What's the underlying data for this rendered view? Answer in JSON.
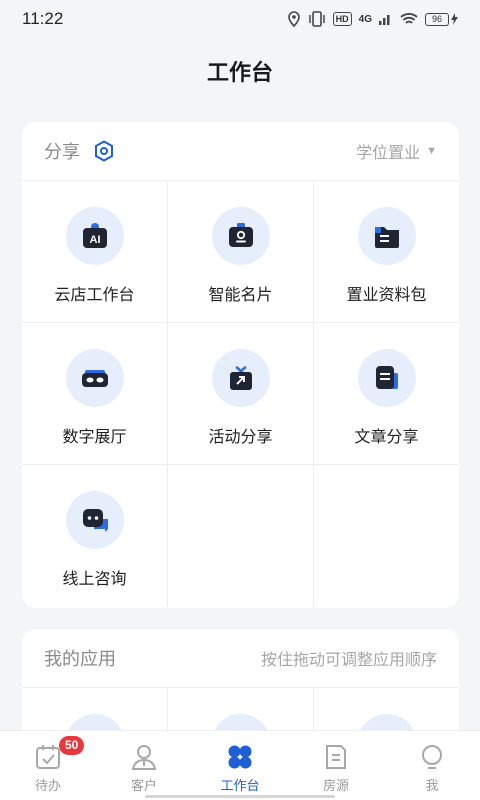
{
  "status_bar": {
    "time": "11:22",
    "hd": "HD",
    "network": "4G",
    "battery": "96"
  },
  "header": {
    "title": "工作台"
  },
  "share_card": {
    "title": "分享",
    "filter_label": "学位置业",
    "items": [
      {
        "label": "云店工作台",
        "icon": "ai-store-icon"
      },
      {
        "label": "智能名片",
        "icon": "business-card-icon"
      },
      {
        "label": "置业资料包",
        "icon": "folder-icon"
      },
      {
        "label": "数字展厅",
        "icon": "vr-goggles-icon"
      },
      {
        "label": "活动分享",
        "icon": "gift-share-icon"
      },
      {
        "label": "文章分享",
        "icon": "article-icon"
      },
      {
        "label": "线上咨询",
        "icon": "chat-consult-icon"
      }
    ]
  },
  "apps_card": {
    "title": "我的应用",
    "hint": "按住拖动可调整应用顺序"
  },
  "tabbar": {
    "items": [
      {
        "label": "待办",
        "icon": "calendar-check-icon",
        "badge": "50"
      },
      {
        "label": "客户",
        "icon": "customer-icon"
      },
      {
        "label": "工作台",
        "icon": "workbench-icon",
        "active": true
      },
      {
        "label": "房源",
        "icon": "listing-doc-icon"
      },
      {
        "label": "我",
        "icon": "profile-icon"
      }
    ]
  },
  "colors": {
    "accent": "#1f5fd6",
    "badge": "#e8383d",
    "icon_bg": "#e6eefb",
    "icon_dark": "#1f2533"
  }
}
